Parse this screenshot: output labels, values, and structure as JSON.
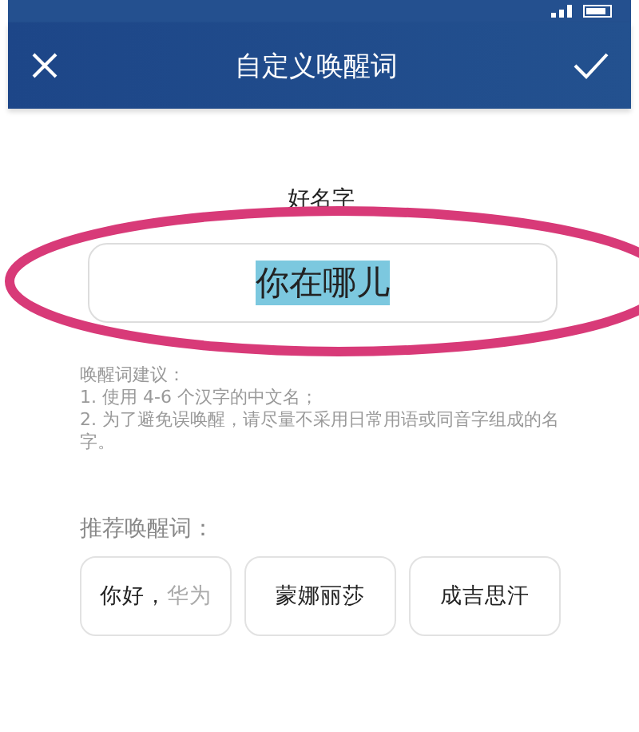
{
  "header": {
    "title": "自定义唤醒词"
  },
  "name_label": "好名字",
  "name_field": {
    "value": "你在哪儿",
    "selected": true
  },
  "tips": [
    "唤醒词建议：",
    "1. 使用 4-6 个汉字的中文名；",
    "2. 为了避免误唤醒，请尽量不采用日常用语或同音字组成的名字。"
  ],
  "recommend_label": "推荐唤醒词：",
  "chips": [
    {
      "label": "你好，",
      "suffix": "华为"
    },
    {
      "label": "蒙娜丽莎"
    },
    {
      "label": "成吉思汗"
    }
  ]
}
